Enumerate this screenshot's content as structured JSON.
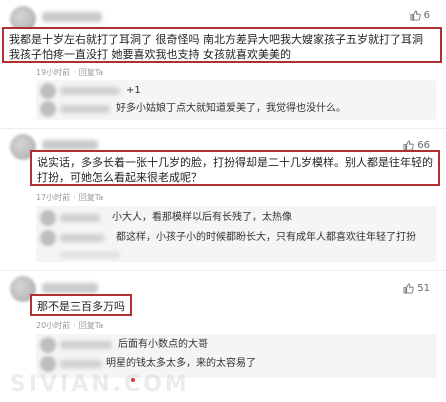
{
  "comments": [
    {
      "likes": "6",
      "text": "我都是十岁左右就打了耳洞了 很奇怪吗 南北方差异大吧我大嫂家孩子五岁就打了耳洞 我孩子怕疼一直没打 她要喜欢我也支持 女孩就喜欢美美的",
      "time": "19小时前",
      "reply_label": "回复Ta",
      "replies": [
        {
          "text": "+1"
        },
        {
          "text": "好多小姑娘丁点大就知道爱美了，我觉得也没什么。"
        }
      ]
    },
    {
      "likes": "66",
      "text": "说实话，多多长着一张十几岁的脸，打扮得却是二十几岁模样。别人都是往年轻的打扮，可她怎么看起来很老成呢？",
      "time": "17小时前",
      "reply_label": "回复Ta",
      "replies": [
        {
          "text": "小大人，看那模样以后有长残了，太热像"
        },
        {
          "text": "都这样，小孩子小的时候都盼长大，只有成年人都喜欢往年轻了打扮"
        }
      ]
    },
    {
      "likes": "51",
      "text": "那不是三百多万吗",
      "time": "20小时前",
      "reply_label": "回复Ta",
      "replies": [
        {
          "text": "后面有小数点的大哥"
        },
        {
          "text": "明星的钱太多太多，来的太容易了"
        }
      ]
    }
  ],
  "watermark": "SIVIAN.COM",
  "colors": {
    "box_border": "#b03030",
    "meta": "#999999",
    "reply_bg": "#f5f5f5"
  },
  "icons": {
    "like": "thumbs-up-icon"
  }
}
